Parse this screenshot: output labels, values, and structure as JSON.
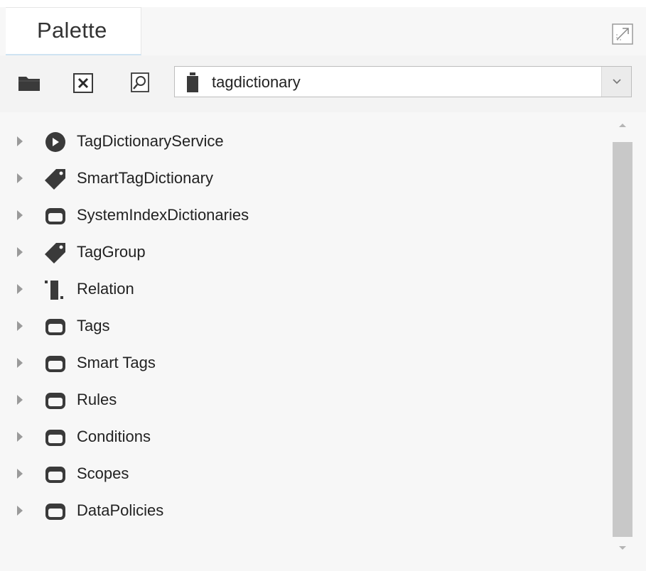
{
  "window": {
    "tab_title": "Palette",
    "maximize_icon": "maximize-icon"
  },
  "toolbar": {
    "buttons": [
      {
        "name": "open-folder",
        "icon": "folder-icon"
      },
      {
        "name": "close",
        "icon": "close-box-icon"
      },
      {
        "name": "find",
        "icon": "find-icon"
      }
    ],
    "module_selector": {
      "value": "tagdictionary",
      "icon": "module-jar-icon"
    }
  },
  "tree": {
    "items": [
      {
        "label": "TagDictionaryService",
        "icon": "service-icon"
      },
      {
        "label": "SmartTagDictionary",
        "icon": "tag-icon"
      },
      {
        "label": "SystemIndexDictionaries",
        "icon": "folder-outline-icon"
      },
      {
        "label": "TagGroup",
        "icon": "tag-icon"
      },
      {
        "label": "Relation",
        "icon": "relation-icon"
      },
      {
        "label": "Tags",
        "icon": "folder-outline-icon"
      },
      {
        "label": "Smart Tags",
        "icon": "folder-outline-icon"
      },
      {
        "label": "Rules",
        "icon": "folder-outline-icon"
      },
      {
        "label": "Conditions",
        "icon": "folder-outline-icon"
      },
      {
        "label": "Scopes",
        "icon": "folder-outline-icon"
      },
      {
        "label": "DataPolicies",
        "icon": "folder-outline-icon"
      }
    ]
  },
  "colors": {
    "icon_dark": "#3a3a3a",
    "panel_bg": "#f7f7f7",
    "scroll_thumb": "#c8c8c8"
  }
}
